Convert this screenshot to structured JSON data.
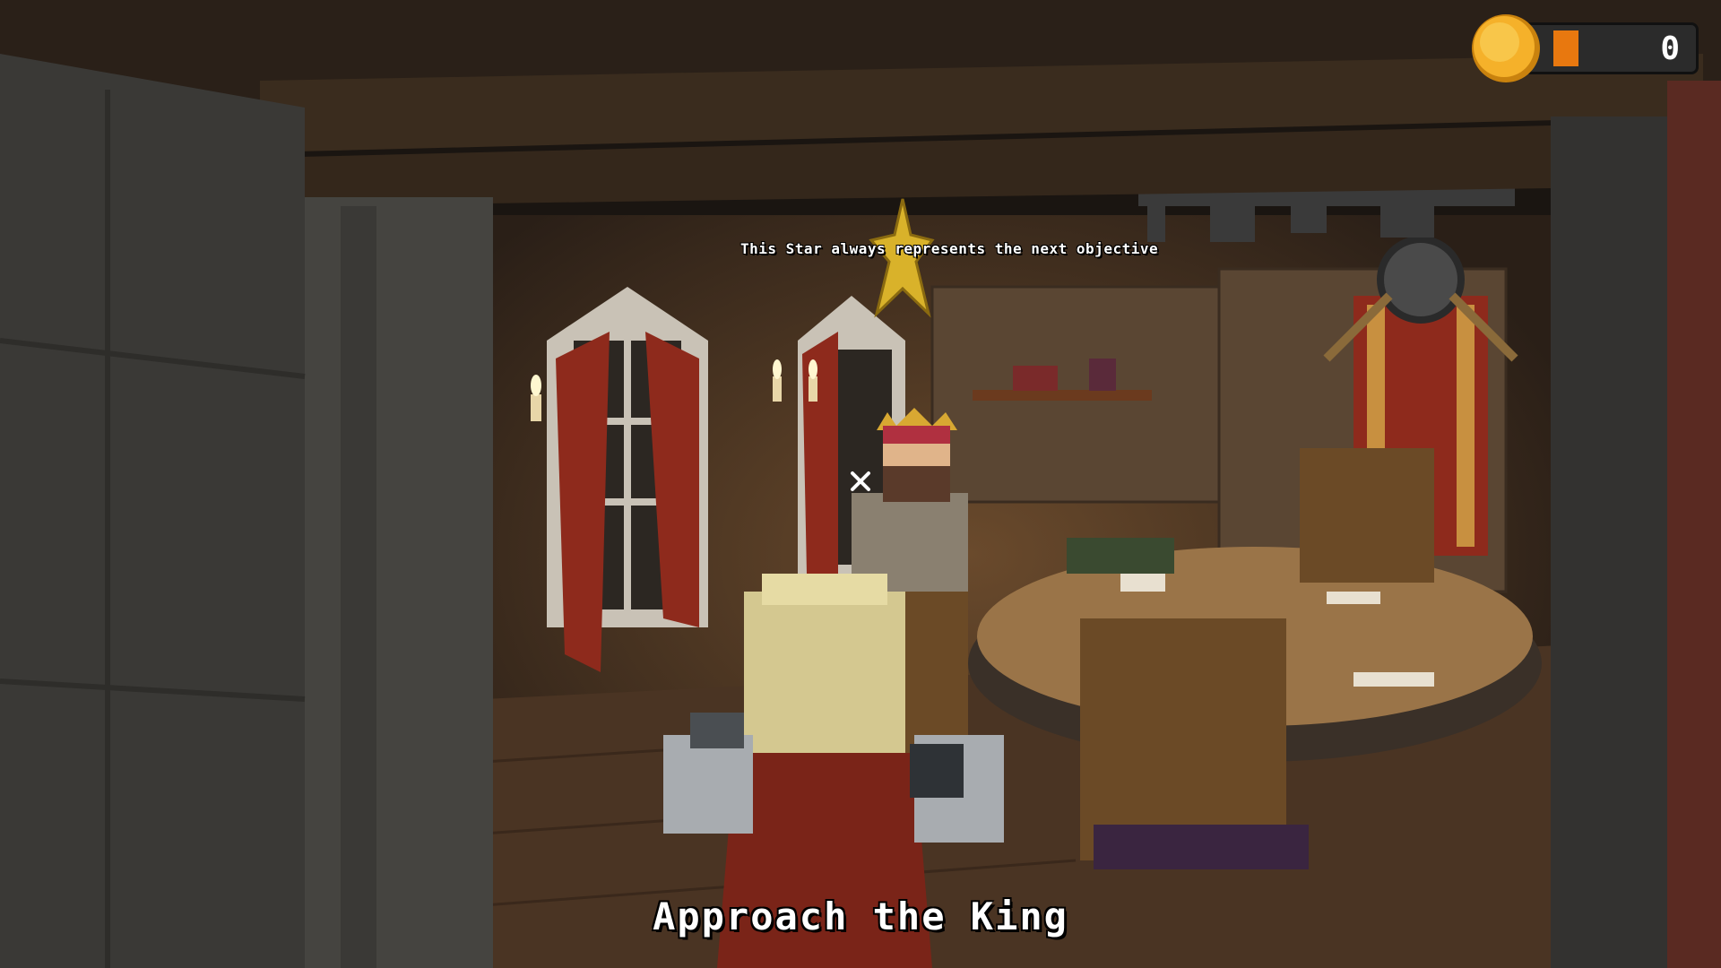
{
  "hud": {
    "coin_count": "0",
    "star_hint": "This Star always represents the next objective",
    "objective": "Approach the King"
  },
  "icons": {
    "coin": "coin-icon",
    "star": "objective-star-icon",
    "crosshair": "crosshair-icon"
  },
  "colors": {
    "coin_gold": "#f5b12a",
    "coin_bar": "#e8780f",
    "star_gold": "#d9b22a",
    "curtain_red": "#8e2a1c"
  }
}
